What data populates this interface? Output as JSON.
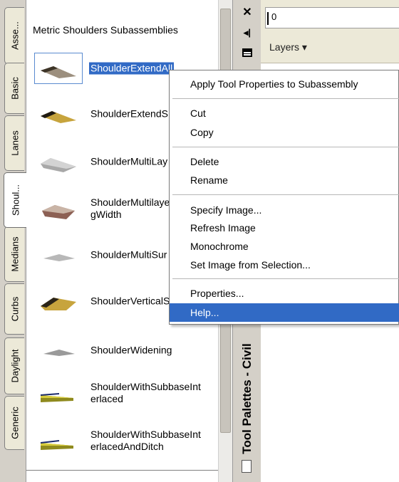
{
  "side_tabs": [
    {
      "label": "Asse...",
      "active": false
    },
    {
      "label": "Basic",
      "active": false
    },
    {
      "label": "Lanes",
      "active": false
    },
    {
      "label": "Shoul...",
      "active": true
    },
    {
      "label": "Medians",
      "active": false
    },
    {
      "label": "Curbs",
      "active": false
    },
    {
      "label": "Daylight",
      "active": false
    },
    {
      "label": "Generic",
      "active": false
    }
  ],
  "palette": {
    "title": "Metric Shoulders Subassemblies",
    "tools": [
      {
        "label": "ShoulderExtendAll",
        "selected": true,
        "icon": "shoulder-extend-all-icon"
      },
      {
        "label": "ShoulderExtendS",
        "selected": false,
        "icon": "shoulder-extend-subbase-icon"
      },
      {
        "label": "ShoulderMultiLay",
        "selected": false,
        "icon": "shoulder-multilayer-icon"
      },
      {
        "label": "ShoulderMultilaye\ngWidth",
        "selected": false,
        "icon": "shoulder-multilayer-width-icon"
      },
      {
        "label": "ShoulderMultiSur",
        "selected": false,
        "icon": "shoulder-multisurface-icon"
      },
      {
        "label": "ShoulderVerticalS",
        "selected": false,
        "icon": "shoulder-vertical-icon"
      },
      {
        "label": "ShoulderWidening",
        "selected": false,
        "icon": "shoulder-widening-icon"
      },
      {
        "label": "ShoulderWithSubbaseInt\nerlaced",
        "selected": false,
        "icon": "shoulder-subbase-interlaced-icon"
      },
      {
        "label": "ShoulderWithSubbaseInt\nerlacedAndDitch",
        "selected": false,
        "icon": "shoulder-subbase-ditch-icon"
      }
    ]
  },
  "titlebar": {
    "close_icon": "close-icon",
    "autohide_icon": "auto-hide-icon",
    "properties_icon": "properties-icon",
    "name": "Tool Palettes - Civil"
  },
  "toolbar": {
    "value": "0",
    "layers_label": "Layers ▾"
  },
  "context_menu": {
    "items": [
      {
        "label": "Apply Tool Properties to Subassembly",
        "highlighted": false
      },
      {
        "label": "Cut",
        "highlighted": false
      },
      {
        "label": "Copy",
        "highlighted": false
      },
      {
        "label": "Delete",
        "highlighted": false
      },
      {
        "label": "Rename",
        "highlighted": false
      },
      {
        "label": "Specify Image...",
        "highlighted": false
      },
      {
        "label": "Refresh Image",
        "highlighted": false
      },
      {
        "label": "Monochrome",
        "highlighted": false
      },
      {
        "label": "Set Image from Selection...",
        "highlighted": false
      },
      {
        "label": "Properties...",
        "highlighted": false
      },
      {
        "label": "Help...",
        "highlighted": true
      }
    ]
  },
  "colors": {
    "selection": "#316ac5",
    "panel": "#d4d0c8",
    "toolbar": "#ece9d8"
  }
}
